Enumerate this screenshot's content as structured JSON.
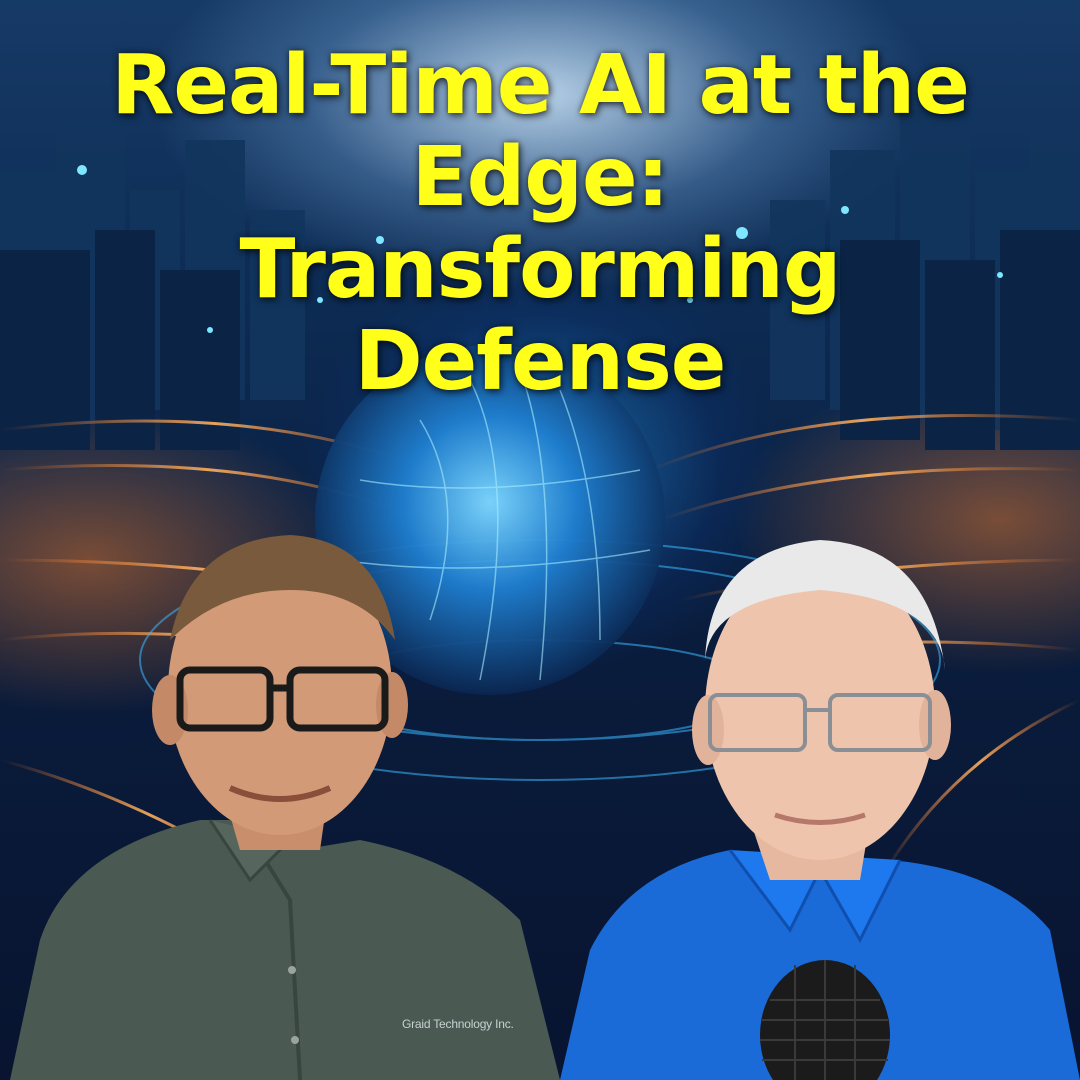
{
  "title": {
    "lines": [
      "Real-Time AI at the",
      "Edge:",
      "Transforming",
      "Defense"
    ],
    "color": "#ffff1a"
  },
  "background": {
    "theme": "futuristic city with glowing digital sphere and light trails",
    "accent_colors": [
      "#2aa8ff",
      "#ff8a2a",
      "#0a1c3c"
    ]
  },
  "left_person": {
    "shirt_color": "#4a5a52",
    "shirt_logo_text": "Graid Technology Inc."
  },
  "right_person": {
    "shirt_color": "#1a6ad8"
  },
  "microphone": {
    "color": "#1b1b1b"
  }
}
